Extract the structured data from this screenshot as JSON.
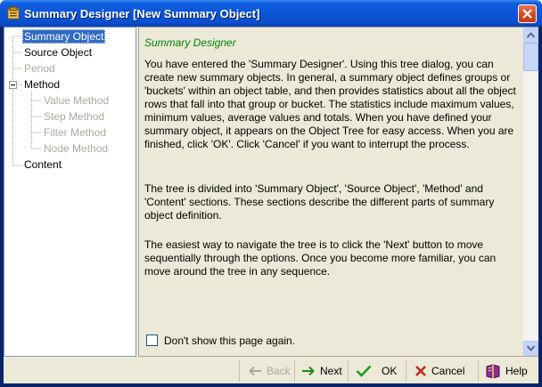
{
  "window": {
    "title": "Summary Designer [New Summary Object]"
  },
  "tree": {
    "items": [
      {
        "label": "Summary Object",
        "state": "selected"
      },
      {
        "label": "Source Object",
        "state": "enabled"
      },
      {
        "label": "Period",
        "state": "disabled"
      },
      {
        "label": "Method",
        "state": "enabled",
        "expanded": true
      },
      {
        "label": "Value Method",
        "state": "disabled"
      },
      {
        "label": "Step Method",
        "state": "disabled"
      },
      {
        "label": "Filter Method",
        "state": "disabled"
      },
      {
        "label": "Node Method",
        "state": "disabled"
      },
      {
        "label": "Content",
        "state": "enabled"
      }
    ]
  },
  "content": {
    "title": "Summary Designer",
    "paragraphs": [
      "You have entered the 'Summary Designer'. Using this tree dialog, you can create new summary objects. In general, a summary object defines groups or 'buckets' within an object table, and then provides statistics about all the object rows that fall into that group or bucket. The statistics include maximum values, minimum values, average values and totals. When you have defined your summary object, it appears on the Object Tree for easy access. When you are finished, click 'OK'. Click 'Cancel' if you want to interrupt the process.",
      "The tree is divided into 'Summary Object', 'Source Object', 'Method' and 'Content' sections. These sections describe the different parts of summary object definition.",
      "The easiest way to navigate the tree is to click the 'Next' button to move sequentially through the options. Once you become more familiar, you can move around the tree in any sequence."
    ],
    "checkbox_label": "Don't show this page again.",
    "checkbox_checked": false
  },
  "buttons": {
    "back": "Back",
    "next": "Next",
    "ok": "OK",
    "cancel": "Cancel",
    "help": "Help"
  },
  "colors": {
    "titlebar": "#0b54d4",
    "selection": "#316ac5",
    "page_title": "#008000",
    "disabled_text": "#aca899"
  }
}
